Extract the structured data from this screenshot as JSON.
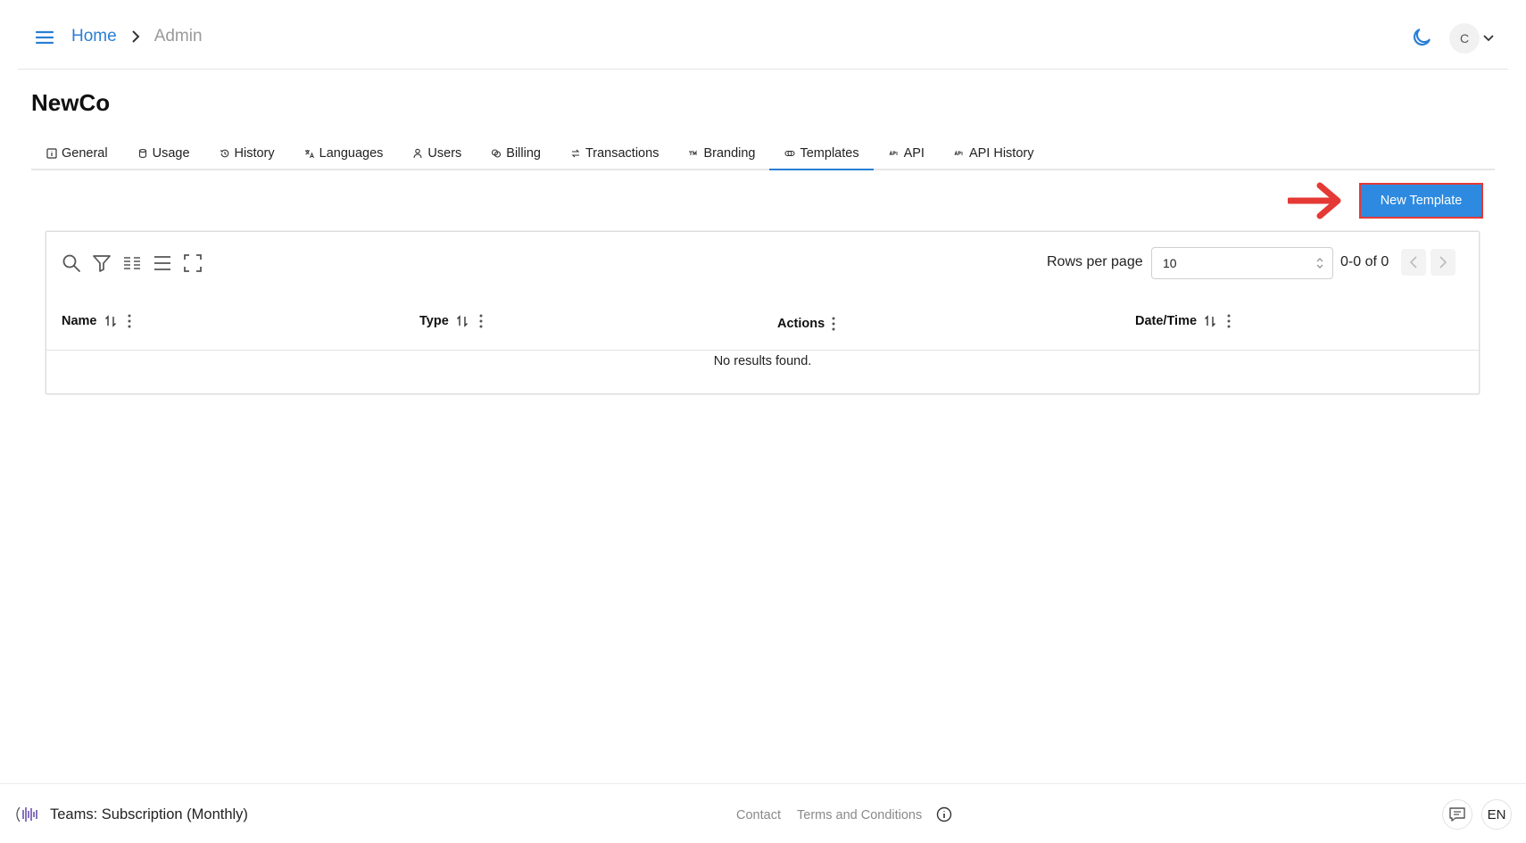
{
  "header": {
    "breadcrumb": {
      "home": "Home",
      "current": "Admin"
    },
    "avatar_initial": "C",
    "accent_color": "#2a7fd4"
  },
  "page": {
    "title": "NewCo"
  },
  "tabs": [
    {
      "label": "General",
      "icon": "info-square-icon"
    },
    {
      "label": "Usage",
      "icon": "database-icon"
    },
    {
      "label": "History",
      "icon": "history-icon"
    },
    {
      "label": "Languages",
      "icon": "translate-icon"
    },
    {
      "label": "Users",
      "icon": "user-icon"
    },
    {
      "label": "Billing",
      "icon": "coins-icon"
    },
    {
      "label": "Transactions",
      "icon": "transfer-icon"
    },
    {
      "label": "Branding",
      "icon": "trademark-icon"
    },
    {
      "label": "Templates",
      "icon": "template-icon",
      "active": true
    },
    {
      "label": "API",
      "icon": "api-icon"
    },
    {
      "label": "API History",
      "icon": "api-icon"
    }
  ],
  "actions": {
    "new_template": "New Template",
    "button_color": "#2d8ae0",
    "highlight_color": "#e53935"
  },
  "table": {
    "toolbar_icons": [
      "search-icon",
      "filter-icon",
      "columns-icon",
      "density-icon",
      "fullscreen-icon"
    ],
    "rows_per_page_label": "Rows per page",
    "rows_per_page_value": "10",
    "page_range": "0-0 of 0",
    "columns": [
      {
        "label": "Name",
        "sortable": true
      },
      {
        "label": "Type",
        "sortable": true
      },
      {
        "label": "Actions",
        "sortable": false
      },
      {
        "label": "Date/Time",
        "sortable": true
      }
    ],
    "empty_text": "No results found."
  },
  "footer": {
    "plan": "Teams: Subscription (Monthly)",
    "contact": "Contact",
    "terms": "Terms and Conditions",
    "language": "EN"
  }
}
